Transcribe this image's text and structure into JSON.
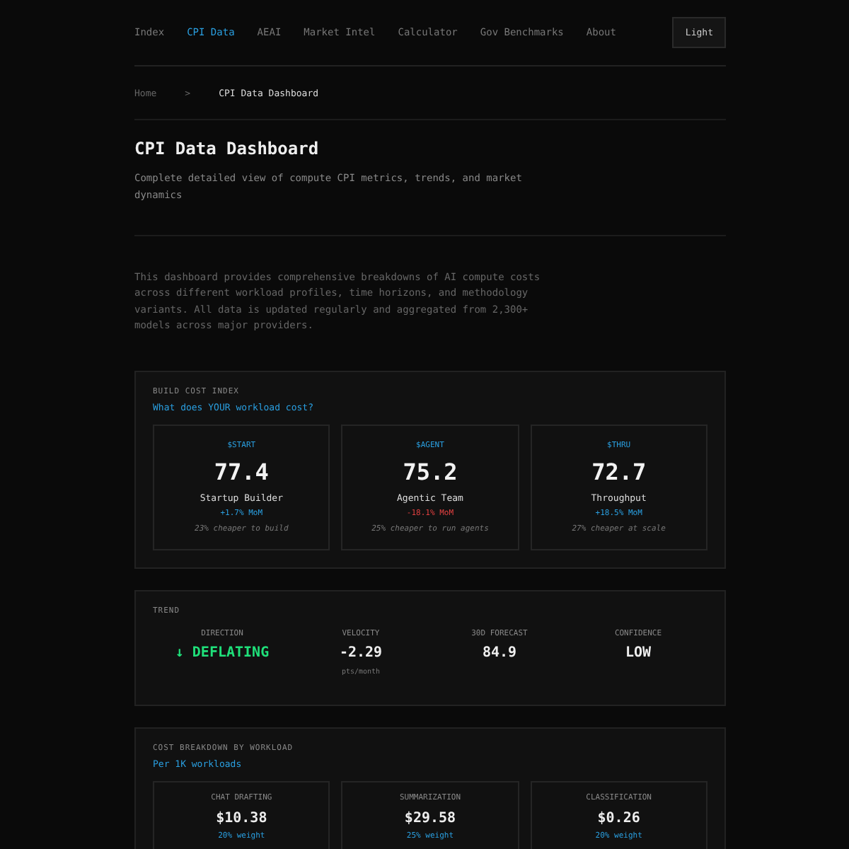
{
  "nav": {
    "items": [
      {
        "label": "Index",
        "selected": false
      },
      {
        "label": "CPI Data",
        "selected": true
      },
      {
        "label": "AEAI",
        "selected": false
      },
      {
        "label": "Market Intel",
        "selected": false
      },
      {
        "label": "Calculator",
        "selected": false
      },
      {
        "label": "Gov Benchmarks",
        "selected": false
      },
      {
        "label": "About",
        "selected": false
      }
    ],
    "theme_button": "Light"
  },
  "breadcrumb": {
    "items": [
      "Home",
      "CPI Data Dashboard"
    ],
    "separator": ">"
  },
  "header": {
    "title": "CPI Data Dashboard",
    "subtitle": "Complete detailed view of compute CPI metrics, trends, and market dynamics"
  },
  "intro": "This dashboard provides comprehensive breakdowns of AI compute costs across different workload profiles, time horizons, and methodology variants. All data is updated regularly and aggregated from 2,300+ models across major providers.",
  "build_cost_index": {
    "label": "BUILD COST INDEX",
    "subtitle": "What does YOUR workload cost?",
    "cards": [
      {
        "ticker": "$START",
        "value": "77.4",
        "name": "Startup Builder",
        "change": "+1.7% MoM",
        "color": "#2a9fe0",
        "note": "23% cheaper to build"
      },
      {
        "ticker": "$AGENT",
        "value": "75.2",
        "name": "Agentic Team",
        "change": "-18.1% MoM",
        "color": "#e04040",
        "note": "25% cheaper to run agents"
      },
      {
        "ticker": "$THRU",
        "value": "72.7",
        "name": "Throughput",
        "change": "+18.5% MoM",
        "color": "#2a9fe0",
        "note": "27% cheaper at scale"
      }
    ]
  },
  "trend": {
    "label": "TREND",
    "stats": [
      {
        "label": "DIRECTION",
        "value": "↓ DEFLATING",
        "color": "#1fe07a"
      },
      {
        "label": "VELOCITY",
        "value": "-2.29",
        "unit": "pts/month",
        "color": "#eeeeee"
      },
      {
        "label": "30D FORECAST",
        "value": "84.9",
        "color": "#eeeeee"
      },
      {
        "label": "CONFIDENCE",
        "value": "LOW",
        "color": "#eeeeee"
      }
    ]
  },
  "cost_breakdown": {
    "label": "COST BREAKDOWN BY WORKLOAD",
    "subtitle": "Per 1K workloads",
    "cards": [
      {
        "name": "CHAT DRAFTING",
        "value": "$10.38",
        "weight": "20% weight"
      },
      {
        "name": "SUMMARIZATION",
        "value": "$29.58",
        "weight": "25% weight"
      },
      {
        "name": "CLASSIFICATION",
        "value": "$0.26",
        "weight": "20% weight"
      }
    ]
  }
}
